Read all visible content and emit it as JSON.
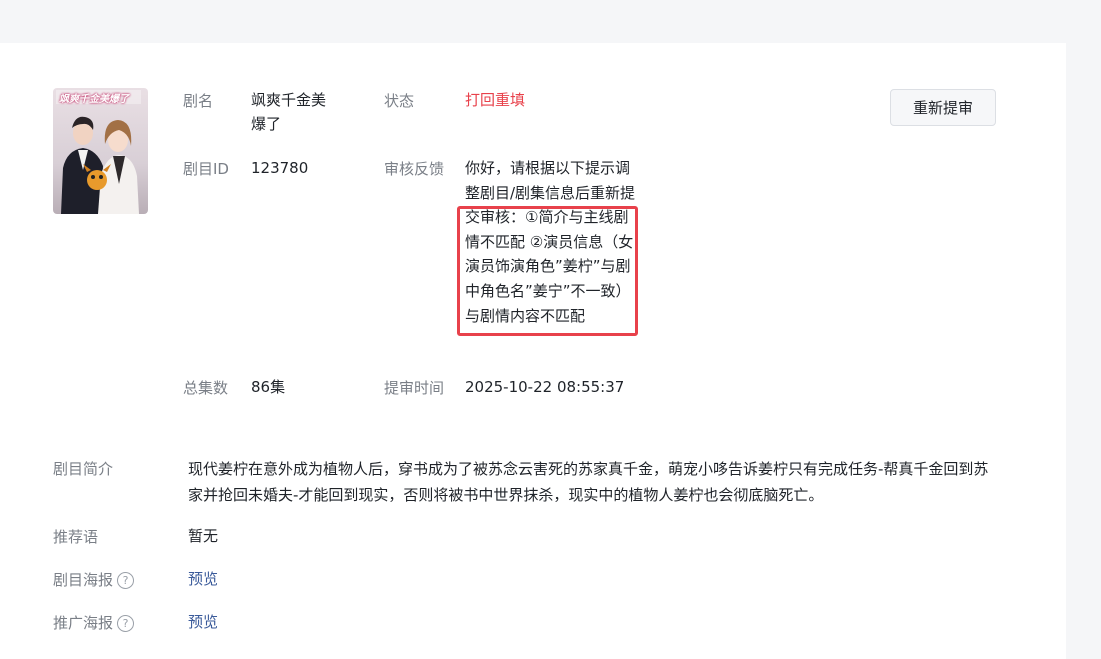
{
  "drama": {
    "name_label": "剧名",
    "name_value": "飒爽千金美爆了",
    "name_line1": "飒爽千金美",
    "name_line2": "爆了",
    "poster_title": "飒爽千金美爆了",
    "id_label": "剧目ID",
    "id_value": "123780",
    "episodes_label": "总集数",
    "episodes_value": "86集",
    "status_label": "状态",
    "status_value": "打回重填",
    "feedback_label": "审核反馈",
    "feedback_value": "你好，请根据以下提示调整剧目/剧集信息后重新提交审核：①简介与主线剧情不匹配 ②演员信息（女演员饰演角色”姜柠”与剧中角色名”姜宁”不一致）与剧情内容不匹配",
    "submit_time_label": "提审时间",
    "submit_time_value": "2025-10-22 08:55:37",
    "resubmit_button": "重新提审"
  },
  "details": {
    "synopsis_label": "剧目简介",
    "synopsis_value": "现代姜柠在意外成为植物人后，穿书成为了被苏念云害死的苏家真千金，萌宠小哆告诉姜柠只有完成任务-帮真千金回到苏家并抢回未婚夫-才能回到现实，否则将被书中世界抹杀，现实中的植物人姜柠也会彻底脑死亡。",
    "recommend_label": "推荐语",
    "recommend_value": "暂无",
    "drama_poster_label": "剧目海报",
    "drama_poster_link": "预览",
    "promo_poster_label": "推广海报",
    "promo_poster_link": "预览",
    "help_icon": "question-circle-icon"
  },
  "colors": {
    "status_red": "#e8414b",
    "link_blue": "#3a5a9a",
    "label_gray": "#7a7f87"
  }
}
